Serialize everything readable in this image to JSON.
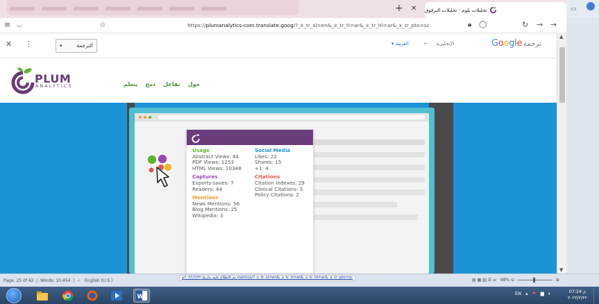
{
  "browser": {
    "tab_title": "تحليلات بلوم - تحليلات البرقوق",
    "url_prefix": "https://",
    "url_host": "plumanalytics-com.translate.goog",
    "url_rest": "/?_x_tr_sl=en&_x_tr_tl=ar&_x_tr_hl=ar&_x_tr_pto=sc"
  },
  "translate": {
    "select_label": "الترجمة",
    "lang_from": "الإنجليزية",
    "arrow": "←",
    "lang_to": "العربية",
    "logo_word": "ترجمة",
    "logo_g": "Google"
  },
  "plum": {
    "logo_word": "PLUM",
    "logo_sub": "ANALYTICS",
    "nav": [
      "حول",
      "تفاعل",
      "دمج",
      "يتعلم"
    ]
  },
  "card": {
    "usage": {
      "title": "Usage",
      "lines": [
        "Abstract Views: 44",
        "PDF Views: 1253",
        "HTML Views: 10348"
      ]
    },
    "captures": {
      "title": "Captures",
      "lines": [
        "Exports-saves: 7",
        "Readers: 44"
      ]
    },
    "mentions": {
      "title": "Mentions",
      "lines": [
        "News Mentions: 56",
        "Blog Mentions: 25",
        "Wikipedia: 3"
      ]
    },
    "social": {
      "title": "Social Media",
      "lines": [
        "Likes: 22",
        "Shares: 15",
        "+1: 4"
      ]
    },
    "citations": {
      "title": "Citations",
      "lines": [
        "Citation Indexes: 29",
        "Clinical Citations: 3",
        "Policy Citations: 2"
      ]
    }
  },
  "status": {
    "page": "Page: 25 of 42",
    "words": "Words: 10,454",
    "lang": "English (U.S.)",
    "hyperlink": "metrics/?_x_tr_sl=en&_x_tr_tl=ar&_x_tr_hl=ar&_x_tr_pto=sc",
    "hyperlink_note": "تم الاطلاع عليه بتاريخ ٢٠٢٢/٢/٢٢م",
    "zoom": "98%"
  },
  "tray": {
    "lang": "EN",
    "time": "07:24 م",
    "date": "٢٠٢٢/٢/٢٢"
  },
  "colors": {
    "usage": "#5cb531",
    "social": "#1e92d1",
    "captures": "#9b49b2",
    "citations": "#e7544e",
    "mentions": "#f0a033",
    "plum_purple": "#6b3c7c",
    "hero_blue": "#1a93d7"
  }
}
